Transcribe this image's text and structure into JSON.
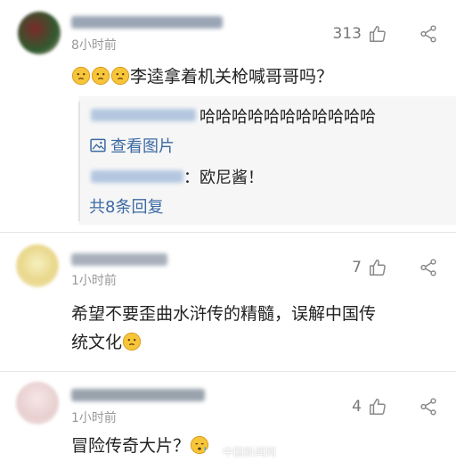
{
  "comments": [
    {
      "time": "8小时前",
      "likes": "313",
      "text": "李逵拿着机关枪喊哥哥吗？",
      "replies": [
        {
          "text": "哈哈哈哈哈哈哈哈哈哈哈"
        },
        {
          "text": "：欧尼酱！"
        }
      ],
      "view_image_label": "查看图片",
      "more_replies_label": "共8条回复"
    },
    {
      "time": "1小时前",
      "likes": "7",
      "text_line1": "希望不要歪曲水浒传的精髓，误解中国传",
      "text_line2": "统文化"
    },
    {
      "time": "1小时前",
      "likes": "4",
      "text": "冒险传奇大片？"
    }
  ],
  "watermark": "中国新闻网",
  "colors": {
    "link_blue": "#3c6aa3",
    "reply_bg": "#f6f6f6",
    "time_gray": "#999999"
  }
}
